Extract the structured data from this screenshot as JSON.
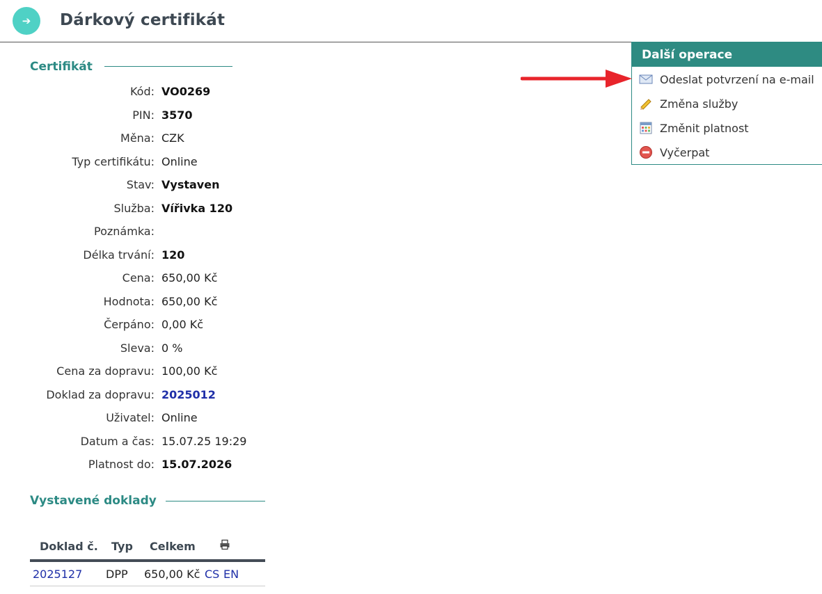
{
  "header": {
    "back_icon": "arrow-right-icon",
    "title": "Dárkový certifikát"
  },
  "certificate": {
    "section_title": "Certifikát",
    "fields": [
      {
        "label": "Kód:",
        "value": "VO0269",
        "style": "bold"
      },
      {
        "label": "PIN:",
        "value": "3570",
        "style": "bold"
      },
      {
        "label": "Měna:",
        "value": "CZK",
        "style": "normal"
      },
      {
        "label": "Typ certifikátu:",
        "value": "Online",
        "style": "normal"
      },
      {
        "label": "Stav:",
        "value": "Vystaven",
        "style": "bold"
      },
      {
        "label": "Služba:",
        "value": "Vířivka 120",
        "style": "bold"
      },
      {
        "label": "Poznámka:",
        "value": "",
        "style": "normal"
      },
      {
        "label": "Délka trvání:",
        "value": "120",
        "style": "bold"
      },
      {
        "label": "Cena:",
        "value": "650,00 Kč",
        "style": "normal"
      },
      {
        "label": "Hodnota:",
        "value": "650,00 Kč",
        "style": "normal"
      },
      {
        "label": "Čerpáno:",
        "value": "0,00 Kč",
        "style": "normal"
      },
      {
        "label": "Sleva:",
        "value": "0 %",
        "style": "normal"
      },
      {
        "label": "Cena za dopravu:",
        "value": "100,00 Kč",
        "style": "normal"
      },
      {
        "label": "Doklad za dopravu:",
        "value": "2025012",
        "style": "link"
      },
      {
        "label": "Uživatel:",
        "value": "Online",
        "style": "normal"
      },
      {
        "label": "Datum a čas:",
        "value": "15.07.25 19:29",
        "style": "normal"
      },
      {
        "label": "Platnost do:",
        "value": "15.07.2026",
        "style": "bold"
      }
    ]
  },
  "operations": {
    "title": "Další operace",
    "items": [
      {
        "label": "Odeslat potvrzení na e-mail",
        "icon": "envelope-icon"
      },
      {
        "label": "Změna služby",
        "icon": "pencil-icon"
      },
      {
        "label": "Změnit platnost",
        "icon": "calendar-icon"
      },
      {
        "label": "Vyčerpat",
        "icon": "minus-circle-icon"
      }
    ]
  },
  "annotation": {
    "arrow_color": "#e8242b"
  },
  "documents": {
    "section_title": "Vystavené doklady",
    "columns": [
      "Doklad č.",
      "Typ",
      "Celkem"
    ],
    "print_icon": "printer-icon",
    "rows": [
      {
        "number": "2025127",
        "type": "DPP",
        "total": "650,00 Kč",
        "links": [
          "CS",
          "EN"
        ]
      }
    ]
  },
  "colors": {
    "accent": "#2e8b82",
    "back_button": "#4fd1c5",
    "link": "#1f2fa8"
  }
}
